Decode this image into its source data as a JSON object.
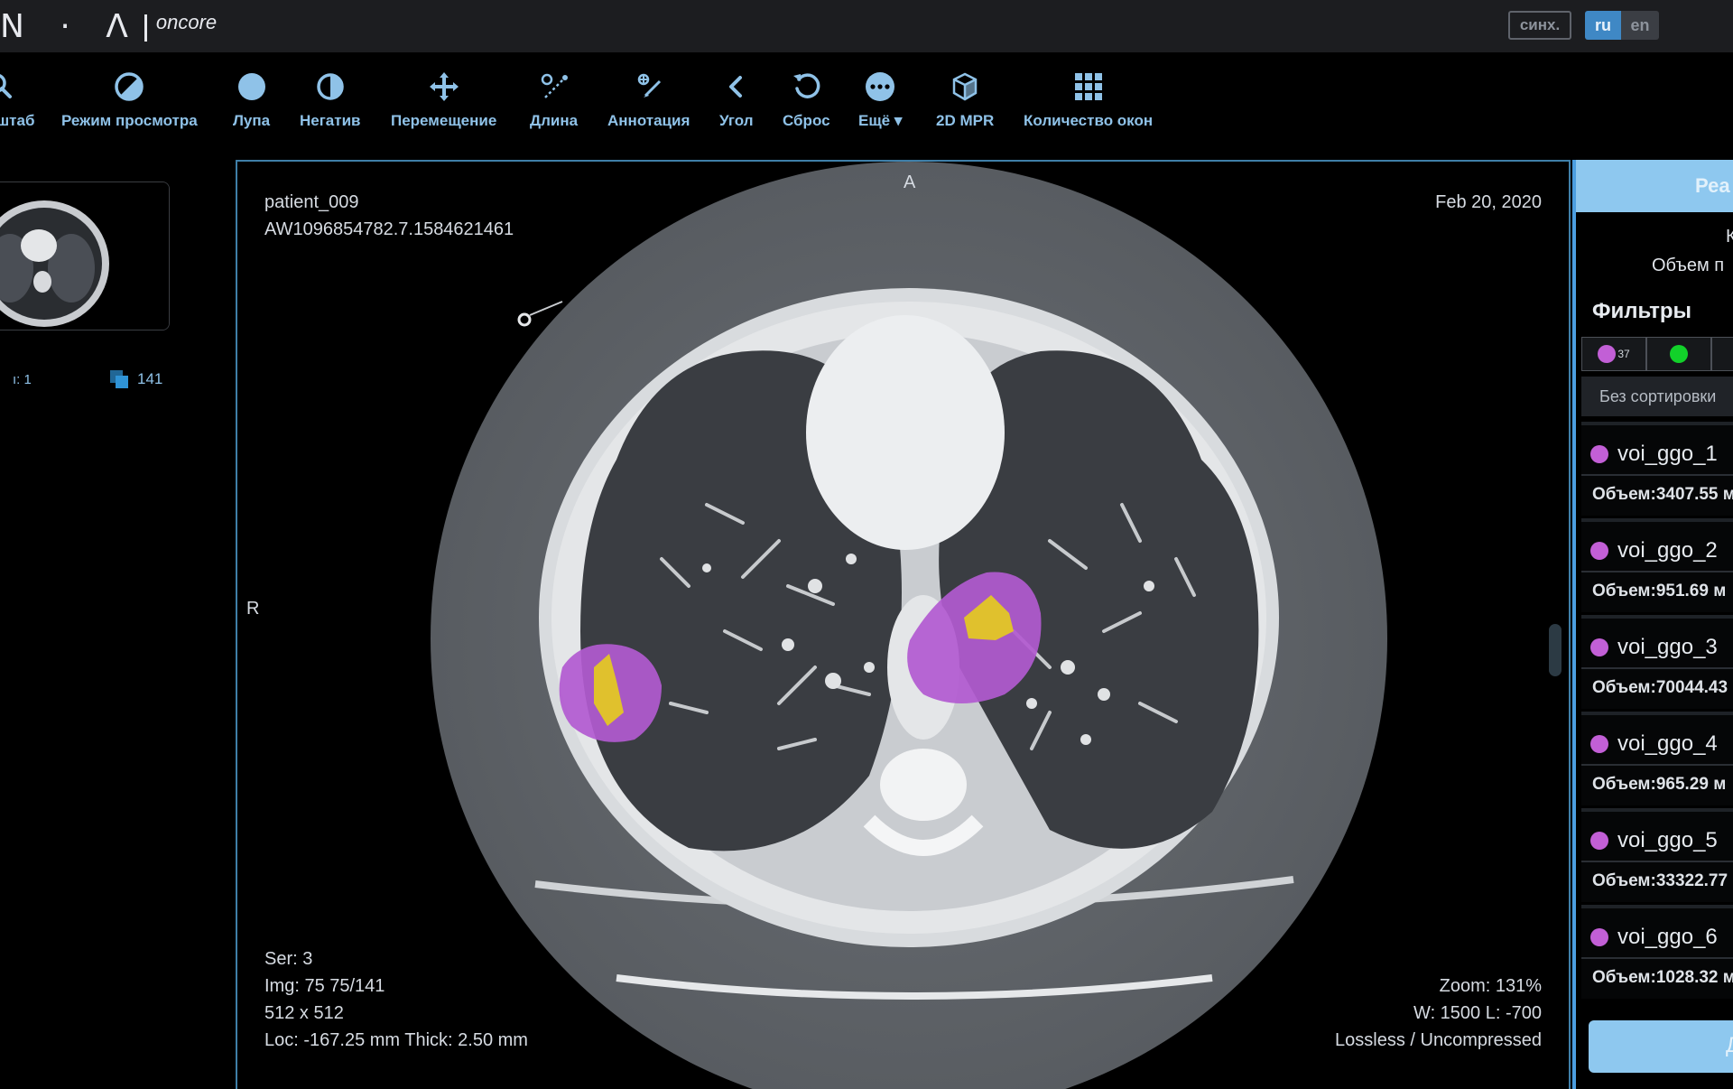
{
  "header": {
    "logo_text": "N · Λ",
    "logo_sub": "oncore",
    "sync_label": "синх.",
    "lang_ru": "ru",
    "lang_en": "en"
  },
  "toolbar": {
    "items": [
      {
        "label": "штаб",
        "icon": "search-icon"
      },
      {
        "label": "Режим просмотра",
        "icon": "contrast-icon"
      },
      {
        "label": "Лупа",
        "icon": "magnifier-circle-icon"
      },
      {
        "label": "Негатив",
        "icon": "half-circle-icon"
      },
      {
        "label": "Перемещение",
        "icon": "move-arrows-icon"
      },
      {
        "label": "Длина",
        "icon": "ruler-icon"
      },
      {
        "label": "Аннотация",
        "icon": "annotation-icon"
      },
      {
        "label": "Угол",
        "icon": "angle-icon"
      },
      {
        "label": "Сброс",
        "icon": "reset-icon"
      },
      {
        "label": "Ещё ▾",
        "icon": "more-icon"
      },
      {
        "label": "2D MPR",
        "icon": "cube-icon"
      },
      {
        "label": "Количество окон",
        "icon": "grid-icon"
      }
    ]
  },
  "thumbs": {
    "series_label": "ı: 1",
    "count": "141"
  },
  "viewport": {
    "patient": "patient_009",
    "uid": "AW1096854782.7.1584621461",
    "date": "Feb 20, 2020",
    "orient_top": "A",
    "orient_left": "R",
    "ser": "Ser: 3",
    "img": "Img: 75 75/141",
    "size": "512 x 512",
    "loc": "Loc: -167.25 mm Thick: 2.50 mm",
    "zoom": "Zoom: 131%",
    "window": "W: 1500 L: -700",
    "compression": "Lossless / Uncompressed"
  },
  "rpanel": {
    "header": "Реа",
    "info1": "К",
    "info2": "Объем п",
    "filters_title": "Фильтры",
    "chips": [
      {
        "color": "#c25fd6",
        "count": "37"
      },
      {
        "color": "#12d12a",
        "count": ""
      },
      {
        "color": "#e8c21a",
        "count": ""
      }
    ],
    "sort_label": "Без сортировки",
    "voi_color": "#c25fd6",
    "vois": [
      {
        "name": "voi_ggo_1",
        "volume": "Объем:3407.55 м"
      },
      {
        "name": "voi_ggo_2",
        "volume": "Объем:951.69 м"
      },
      {
        "name": "voi_ggo_3",
        "volume": "Объем:70044.43"
      },
      {
        "name": "voi_ggo_4",
        "volume": "Объем:965.29 м"
      },
      {
        "name": "voi_ggo_5",
        "volume": "Объем:33322.77"
      },
      {
        "name": "voi_ggo_6",
        "volume": "Объем:1028.32 м"
      }
    ],
    "button_label": "Д"
  },
  "colors": {
    "accent": "#8fc2e8",
    "panel_header": "#8ec8ef",
    "viewport_border": "#3f7fa8",
    "ggo_purple": "#b25ad0",
    "ggo_yellow": "#e0c12d"
  }
}
